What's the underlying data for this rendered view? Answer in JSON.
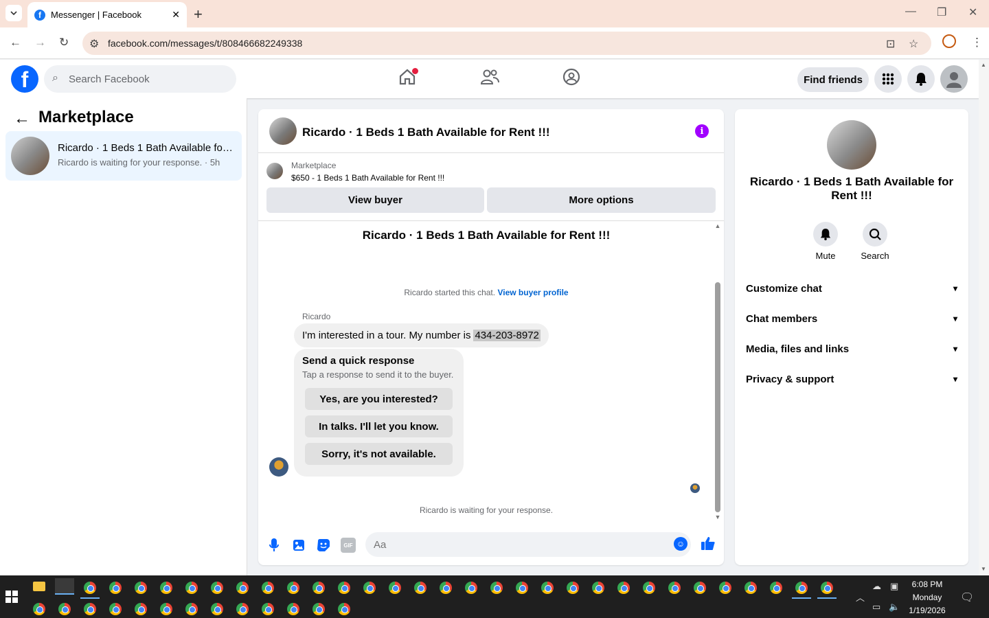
{
  "browser": {
    "tab_title": "Messenger | Facebook",
    "tab_favicon": "facebook-favicon",
    "url": "facebook.com/messages/t/808466682249338"
  },
  "header": {
    "search_placeholder": "Search Facebook",
    "find_friends_label": "Find friends",
    "nav_icons": [
      "home-icon",
      "friends-icon",
      "groups-icon"
    ],
    "brand_color": "#0866ff",
    "notification_dot_color": "#e41e3f"
  },
  "left_pane": {
    "title": "Marketplace",
    "conversations": [
      {
        "title": "Ricardo · 1 Beds 1 Bath Available for Rent !!!",
        "subtitle": "Ricardo is waiting for your response. · 5h"
      }
    ]
  },
  "chat": {
    "header_title": "Ricardo · 1 Beds 1 Bath Available for Rent !!!",
    "listing_source": "Marketplace",
    "listing_title": "$650 - 1 Beds 1 Bath Available for Rent !!!",
    "view_buyer_label": "View buyer",
    "more_options_label": "More options",
    "thread_title": "Ricardo · 1 Beds 1 Bath Available for Rent !!!",
    "started_text": "Ricardo started this chat.",
    "view_buyer_profile_label": "View buyer profile",
    "sender_name": "Ricardo",
    "message_text": "I'm interested in a tour. My number is",
    "message_phone": "434-203-8972",
    "quick_response_title": "Send a quick response",
    "quick_response_subtitle": "Tap a response to send it to the buyer.",
    "quick_responses": [
      "Yes, are you interested?",
      "In talks. I'll let you know.",
      "Sorry, it's not available."
    ],
    "waiting_text": "Ricardo is waiting for your response.",
    "composer_placeholder": "Aa",
    "accent_color": "#a100ff"
  },
  "right_pane": {
    "name": "Ricardo · 1 Beds 1 Bath Available for Rent !!!",
    "mute_label": "Mute",
    "search_label": "Search",
    "sections": [
      "Customize chat",
      "Chat members",
      "Media, files and links",
      "Privacy & support"
    ]
  },
  "taskbar": {
    "time": "6:08 PM",
    "day": "Monday",
    "date": "1/19/2026"
  }
}
